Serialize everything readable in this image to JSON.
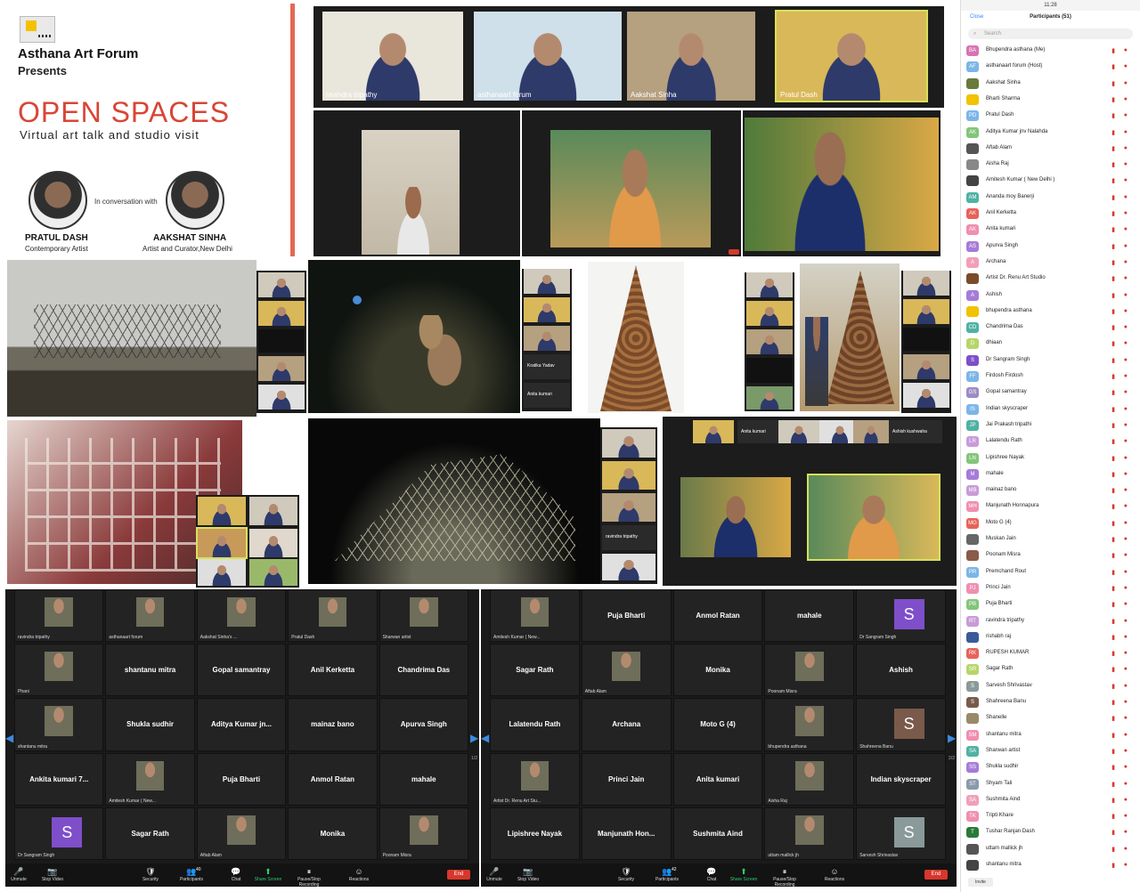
{
  "poster": {
    "org": "Asthana Art Forum",
    "presents": "Presents",
    "title": "OPEN SPACES",
    "subtitle": "Virtual art talk and studio visit",
    "conversation": "In conversation with",
    "speaker1_name": "PRATUL DASH",
    "speaker1_role": "Contemporary Artist",
    "speaker2_name": "AAKSHAT SINHA",
    "speaker2_role": "Artist and Curator,New Delhi"
  },
  "top_strip": {
    "tiles": [
      "ravindra tripathy",
      "asthanaart forum",
      "Aakshat Sinha",
      "Pratul Dash"
    ]
  },
  "small_side_labels": {
    "side1": [
      "",
      "",
      "Kratika Yadav",
      "Anita kumari"
    ],
    "mid_right": [
      "Anita kumari",
      "Ashish kushwaha"
    ],
    "night_side": [
      "",
      "",
      "",
      "ravindra tripathy"
    ]
  },
  "gallery1": {
    "row1": [
      "ravindra tripathy",
      "asthanaart forum",
      "Aakshat Sinha's ...",
      "Pratul Dash",
      "Sharwan artist"
    ],
    "row2": [
      "Phani",
      "shantanu mitra",
      "Gopal samantray",
      "Anil Kerketta",
      "Chandrima Das"
    ],
    "row3": [
      "shantanu mitra",
      "Shukla sudhir",
      "Aditya  Kumar  jn...",
      "mainaz bano",
      "Apurva Singh"
    ],
    "row4": [
      "Ankita kumari 7...",
      "Amitesh Kumar ( New...",
      "Puja Bharti",
      "Anmol Ratan",
      "mahale"
    ],
    "row5": [
      "Dr Sangram Singh",
      "Sagar Rath",
      "Aftab Alam",
      "Monika",
      "Poonam Misra"
    ],
    "page": "1/2",
    "toolbar": [
      "Unmute",
      "Stop Video",
      "Security",
      "Participants",
      "Chat",
      "Share Screen",
      "Pause/Stop Recording",
      "Reactions"
    ],
    "participants_count": "40",
    "end": "End"
  },
  "gallery2": {
    "row1": [
      "Amitesh Kumar ( New...",
      "Puja Bharti",
      "Anmol Ratan",
      "mahale",
      "Dr Sangram Singh"
    ],
    "row2": [
      "Sagar Rath",
      "Aftab Alam",
      "Monika",
      "Poonam Misra",
      "Ashish"
    ],
    "row3": [
      "Lalatendu Rath",
      "Archana",
      "Moto G (4)",
      "bhupendra asthana",
      "Shahreena Banu"
    ],
    "row4": [
      "Artist Dr. Renu Art Stu...",
      "Princi Jain",
      "Anita kumari",
      "Aisha Raj",
      "Indian skyscraper"
    ],
    "row5": [
      "Lipishree Nayak",
      "Manjunath  Hon...",
      "Sushmita Aind",
      "uttam mallick jh",
      "Sarvesh Shrivastav"
    ],
    "page": "2/2",
    "participants_count": "42",
    "end": "End"
  },
  "phone": {
    "time": "11:28",
    "close": "Close",
    "title": "Participants (51)",
    "search": "Search",
    "invite": "Invite",
    "participants": [
      {
        "i": "BA",
        "c": "#d873b5",
        "n": "Bhupendra asthana (Me)"
      },
      {
        "i": "AF",
        "c": "#7bb6e8",
        "n": "asthanaart forum (Host)"
      },
      {
        "i": "",
        "c": "#6a7a3a",
        "n": "Aakshat Sinha"
      },
      {
        "i": "",
        "c": "#f2c200",
        "n": "Bharti Sharma"
      },
      {
        "i": "PD",
        "c": "#7bb6e8",
        "n": "Pratul Dash"
      },
      {
        "i": "AK",
        "c": "#83c57a",
        "n": "Aditya Kumar jnv Nalahda"
      },
      {
        "i": "",
        "c": "#555",
        "n": "Aftab Alam"
      },
      {
        "i": "",
        "c": "#888",
        "n": "Aisha Raj"
      },
      {
        "i": "",
        "c": "#444",
        "n": "Amitesh Kumar ( New Delhi )"
      },
      {
        "i": "AM",
        "c": "#4fb2a3",
        "n": "Ananda moy Banerji"
      },
      {
        "i": "AK",
        "c": "#e8625a",
        "n": "Anil Kerketta"
      },
      {
        "i": "AK",
        "c": "#f08fb0",
        "n": "Anita kumari"
      },
      {
        "i": "AS",
        "c": "#a77bd8",
        "n": "Apurva Singh"
      },
      {
        "i": "A",
        "c": "#f0a0b8",
        "n": "Archana"
      },
      {
        "i": "",
        "c": "#7a4a2a",
        "n": "Artist Dr. Renu Art Studio"
      },
      {
        "i": "A",
        "c": "#a77bd8",
        "n": "Ashish"
      },
      {
        "i": "",
        "c": "#f2c200",
        "n": "bhupendra asthana"
      },
      {
        "i": "CD",
        "c": "#4fb2a3",
        "n": "Chandrima Das"
      },
      {
        "i": "D",
        "c": "#b6d66a",
        "n": "dhiaan"
      },
      {
        "i": "S",
        "c": "#7e4fc9",
        "n": "Dr Sangram Singh"
      },
      {
        "i": "FF",
        "c": "#7bb6e8",
        "n": "Firdosh Firdosh"
      },
      {
        "i": "GS",
        "c": "#9e8bc4",
        "n": "Gopal samantray"
      },
      {
        "i": "IS",
        "c": "#7bb6e8",
        "n": "Indian skyscraper"
      },
      {
        "i": "JP",
        "c": "#4fb2a3",
        "n": "Jai Prakash tripathi"
      },
      {
        "i": "LR",
        "c": "#c99bd8",
        "n": "Lalatendu Rath"
      },
      {
        "i": "LN",
        "c": "#83c57a",
        "n": "Lipishree Nayak"
      },
      {
        "i": "M",
        "c": "#a77bd8",
        "n": "mahale"
      },
      {
        "i": "MB",
        "c": "#c99bd8",
        "n": "mainaz bano"
      },
      {
        "i": "MH",
        "c": "#f08fb0",
        "n": "Manjunath Honnapura"
      },
      {
        "i": "MG",
        "c": "#e8625a",
        "n": "Moto G (4)"
      },
      {
        "i": "",
        "c": "#666",
        "n": "Muskan Jain"
      },
      {
        "i": "",
        "c": "#8a5a4a",
        "n": "Poonam Misra"
      },
      {
        "i": "PR",
        "c": "#7bb6e8",
        "n": "Premchand Rout"
      },
      {
        "i": "PJ",
        "c": "#f08fb0",
        "n": "Princi Jain"
      },
      {
        "i": "PB",
        "c": "#83c57a",
        "n": "Puja Bharti"
      },
      {
        "i": "RT",
        "c": "#c99bd8",
        "n": "ravindra tripathy"
      },
      {
        "i": "",
        "c": "#3a5a9a",
        "n": "rishabh raj"
      },
      {
        "i": "RK",
        "c": "#e8625a",
        "n": "RUPESH KUMAR"
      },
      {
        "i": "SR",
        "c": "#b6d66a",
        "n": "Sagar Rath"
      },
      {
        "i": "S",
        "c": "#8a9a9a",
        "n": "Sarvesh Shrivastav"
      },
      {
        "i": "S",
        "c": "#7a5a4a",
        "n": "Shahreena Banu"
      },
      {
        "i": "",
        "c": "#9a8a6a",
        "n": "Shanelle"
      },
      {
        "i": "SM",
        "c": "#f08fb0",
        "n": "shantanu mitra"
      },
      {
        "i": "SA",
        "c": "#4fb2a3",
        "n": "Sharwan artist"
      },
      {
        "i": "SS",
        "c": "#a77bd8",
        "n": "Shukla sudhir"
      },
      {
        "i": "ST",
        "c": "#8a9aaa",
        "n": "Shyam Tali"
      },
      {
        "i": "SA",
        "c": "#f0a0b8",
        "n": "Sushmita Aind"
      },
      {
        "i": "TK",
        "c": "#f08fb0",
        "n": "Tripti Khare"
      },
      {
        "i": "T",
        "c": "#2a7a3a",
        "n": "Tushar Ranjan Dash"
      },
      {
        "i": "",
        "c": "#555",
        "n": "uttam mallick jh"
      },
      {
        "i": "",
        "c": "#444",
        "n": "shantanu mitra"
      }
    ]
  }
}
